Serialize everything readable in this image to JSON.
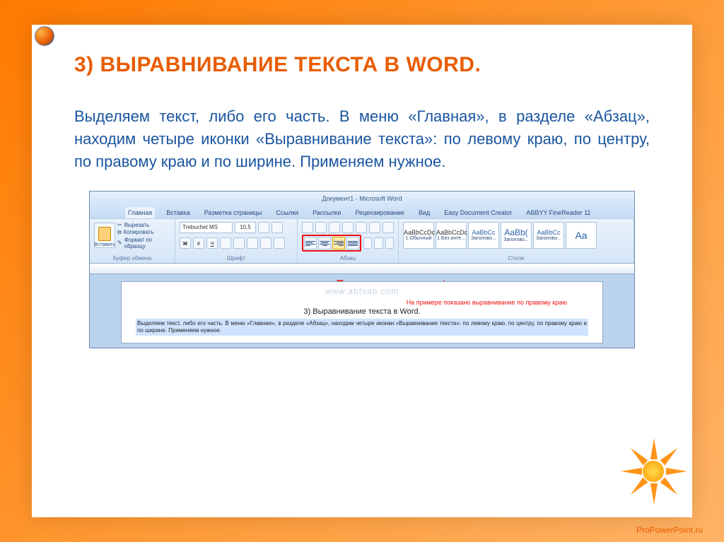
{
  "title": "3) ВЫРАВНИВАНИЕ ТЕКСТА В WORD.",
  "body": "Выделяем текст, либо его часть. В меню «Главная», в разделе «Абзац», находим четыре иконки «Выравнивание текста»: по левому краю, по центру, по правому краю и по ширине. Применяем нужное.",
  "word": {
    "title": "Документ1 - Microsoft Word",
    "tabs": [
      "Главная",
      "Вставка",
      "Разметка страницы",
      "Ссылки",
      "Рассылки",
      "Рецензирование",
      "Вид",
      "Easy Document Creator",
      "ABBYY FineReader 11"
    ],
    "clipboard": {
      "paste": "Вставить",
      "cut": "Вырезать",
      "copy": "Копировать",
      "format": "Формат по образцу",
      "label": "Буфер обмена"
    },
    "font": {
      "name": "Trebuchet MS",
      "size": "10,5",
      "label": "Шрифт"
    },
    "paragraph": {
      "label": "Абзац"
    },
    "styles": {
      "items": [
        {
          "preview": "AaBbCcDc",
          "name": "1 Обычный"
        },
        {
          "preview": "AaBbCcDc",
          "name": "1 Без инте..."
        },
        {
          "preview": "AaBbCc",
          "name": "Заголово..."
        },
        {
          "preview": "AaBb(",
          "name": "Заголово..."
        },
        {
          "preview": "AaBbCc",
          "name": "Заголово..."
        },
        {
          "preview": "Aa",
          "name": ""
        }
      ],
      "label": "Стили"
    },
    "page": {
      "watermark": "www.abfsab.com",
      "annotation": "На примере показано выравнивание по правому краю",
      "heading": "3) Выравнивание текста в Word.",
      "paragraph": "Выделяем текст, либо его часть. В меню «Главная», в разделе «Абзац», находим четыре иконки «Выравнивание текста»: по левому краю, по центру, по правому краю и по ширине. Применяем нужное."
    }
  },
  "footer": "ProPowerPoint.ru"
}
